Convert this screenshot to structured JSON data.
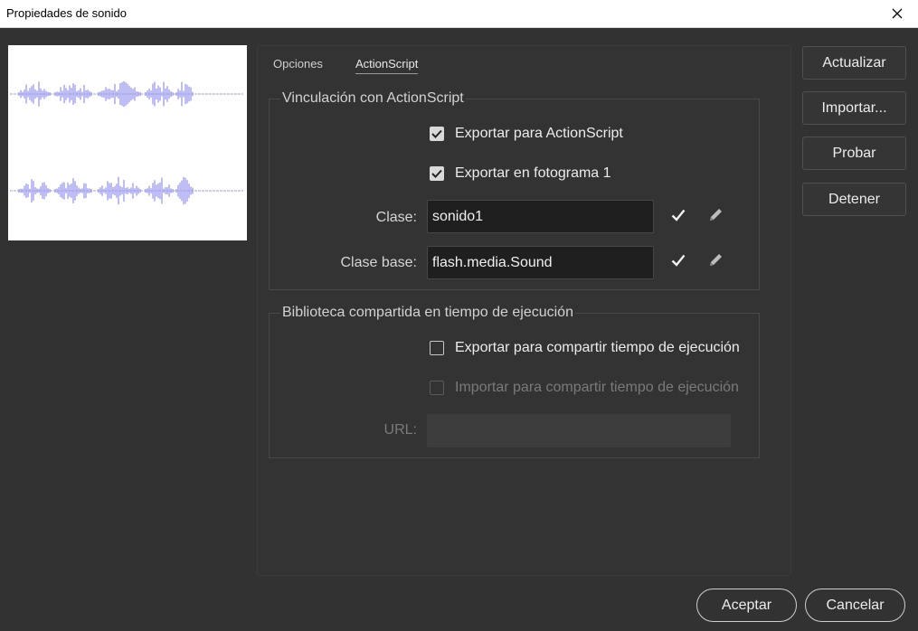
{
  "window": {
    "title": "Propiedades de sonido",
    "close_icon": "close-icon"
  },
  "preview": {
    "waveform_color": "#9b9bee",
    "background": "#ffffff"
  },
  "tabs": [
    {
      "label": "Opciones",
      "active": false
    },
    {
      "label": "ActionScript",
      "active": true
    }
  ],
  "linkage": {
    "legend": "Vinculación con ActionScript",
    "export_actionscript": {
      "label": "Exportar para ActionScript",
      "checked": true
    },
    "export_frame1": {
      "label": "Exportar en fotograma 1",
      "checked": true
    },
    "class": {
      "label": "Clase:",
      "value": "sonido1"
    },
    "base_class": {
      "label": "Clase base:",
      "value": "flash.media.Sound"
    }
  },
  "shared_library": {
    "legend": "Biblioteca compartida en tiempo de ejecución",
    "export_runtime": {
      "label": "Exportar para compartir tiempo de ejecución",
      "checked": false
    },
    "import_runtime": {
      "label": "Importar para compartir tiempo de ejecución",
      "checked": false,
      "enabled": false
    },
    "url": {
      "label": "URL:",
      "value": "",
      "enabled": false
    }
  },
  "side_buttons": {
    "update": "Actualizar",
    "import": "Importar...",
    "test": "Probar",
    "stop": "Detener"
  },
  "footer": {
    "ok": "Aceptar",
    "cancel": "Cancelar"
  }
}
